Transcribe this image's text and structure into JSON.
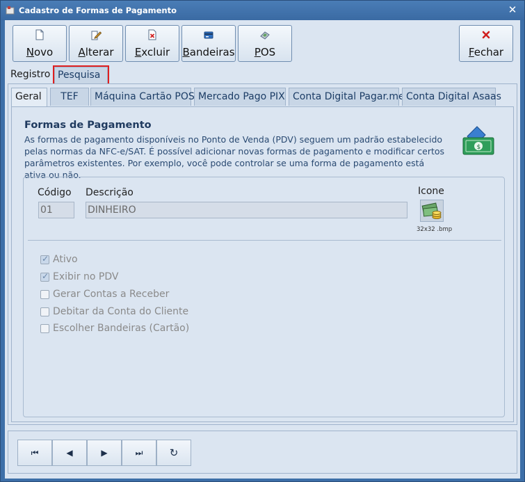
{
  "window": {
    "title": "Cadastro de Formas de Pagamento",
    "close_glyph": "✕"
  },
  "toolbar": {
    "novo": {
      "accel": "N",
      "rest": "ovo",
      "icon": "new-document-icon"
    },
    "alterar": {
      "accel": "A",
      "rest": "lterar",
      "icon": "edit-pencil-icon"
    },
    "excluir": {
      "accel": "E",
      "rest": "xcluir",
      "icon": "delete-document-icon"
    },
    "bandeiras": {
      "accel": "B",
      "rest": "andeiras",
      "icon": "card-flag-icon"
    },
    "pos": {
      "accel": "P",
      "rest": "OS",
      "icon": "pos-terminal-icon"
    },
    "fechar": {
      "accel": "F",
      "rest": "echar",
      "icon": "close-x-icon"
    }
  },
  "page_tabs": {
    "registro": "Registro",
    "pesquisa": "Pesquisa"
  },
  "sub_tabs": {
    "geral": "Geral",
    "tef": "TEF",
    "maquina": "Máquina Cartão POS",
    "mercado_pago": "Mercado Pago PIX",
    "pagar_me": "Conta Digital Pagar.me",
    "asaas": "Conta Digital Asaas"
  },
  "info": {
    "title": "Formas de Pagamento",
    "text": "As formas de pagamento disponíveis no Ponto de Venda (PDV) seguem um padrão estabelecido pelas normas da NFC-e/SAT. É possível adicionar novas formas de pagamento e modificar certos parâmetros existentes. Por exemplo, você pode controlar se uma forma de pagamento está ativa ou não."
  },
  "form": {
    "codigo_label": "Código",
    "codigo_value": "01",
    "descricao_label": "Descrição",
    "descricao_value": "DINHEIRO",
    "icone_label": "Icone",
    "icone_caption": "32x32 .bmp"
  },
  "options": {
    "ativo": {
      "label": "Ativo",
      "checked": true
    },
    "exibir_pdv": {
      "label": "Exibir no PDV",
      "checked": true
    },
    "gerar_contas": {
      "label": "Gerar Contas a Receber",
      "checked": false
    },
    "debitar_conta": {
      "label": "Debitar da Conta do Cliente",
      "checked": false
    },
    "escolher_bandeiras": {
      "label": "Escolher Bandeiras (Cartão)",
      "checked": false
    }
  },
  "nav": {
    "first": "⏮",
    "prev": "◀",
    "next": "▶",
    "last": "⏭",
    "refresh": "↻"
  },
  "colors": {
    "accent": "#3d6fa8",
    "panel": "#dbe5f1",
    "highlight": "#e02020",
    "money_green": "#2f9e5a"
  }
}
